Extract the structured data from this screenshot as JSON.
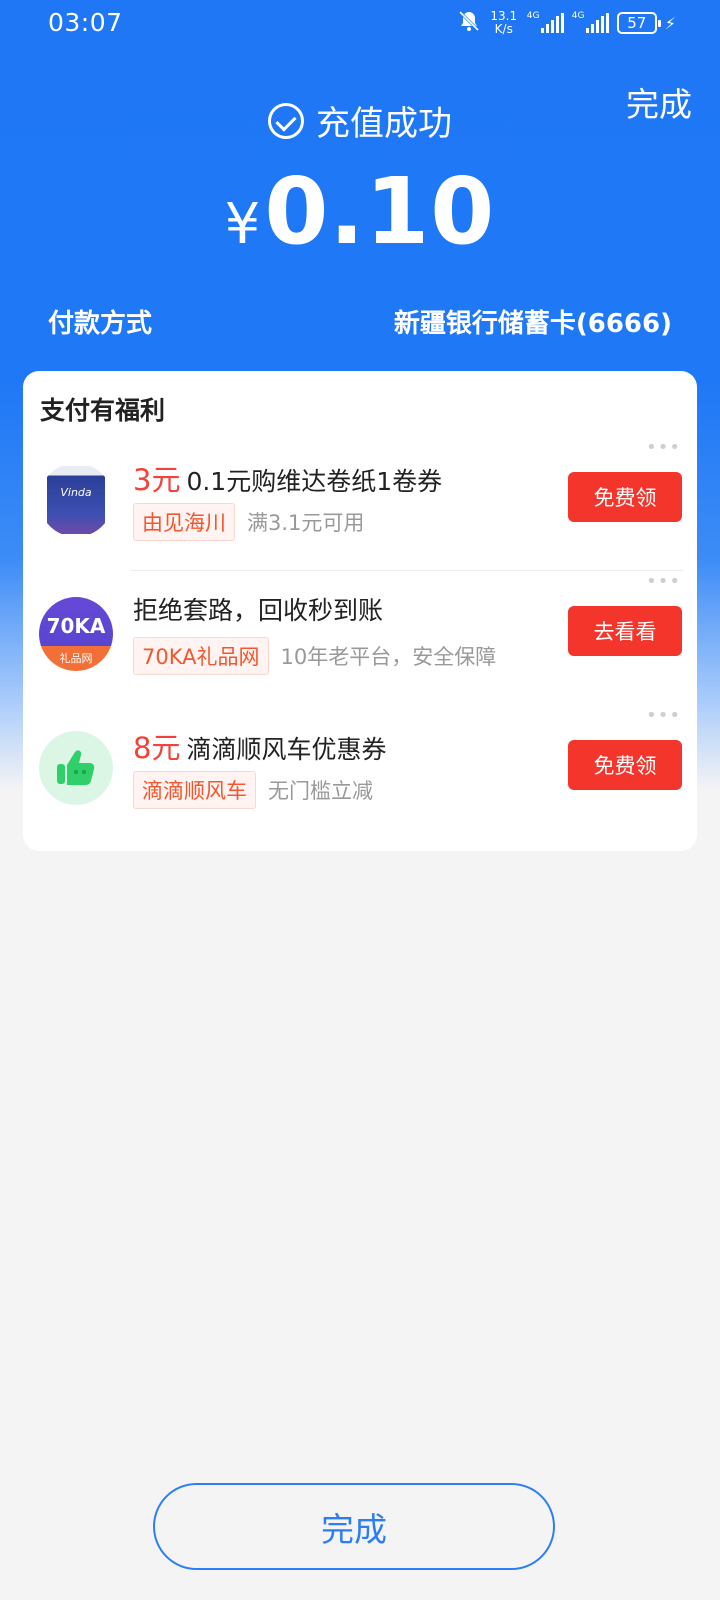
{
  "status_bar": {
    "time": "03:07",
    "net_speed_value": "13.1",
    "net_speed_unit": "K/s",
    "signal_tag": "4G",
    "battery": "57",
    "icons": [
      "bell-muted-icon",
      "signal-icon",
      "battery-icon",
      "charging-icon"
    ]
  },
  "header": {
    "done_label": "完成",
    "success_text": "充值成功",
    "currency": "¥",
    "amount": "0.10"
  },
  "payment": {
    "label": "付款方式",
    "value": "新疆银行储蓄卡(6666)"
  },
  "benefits": {
    "title": "支付有福利",
    "items": [
      {
        "price": "3元",
        "title": "0.1元购维达卷纸1卷券",
        "chip": "由见海川",
        "note": "满3.1元可用",
        "button": "免费领",
        "logo_text": "Vinda",
        "icon": "toilet-paper-icon"
      },
      {
        "price": "",
        "title": "拒绝套路，回收秒到账",
        "chip": "70KA礼品网",
        "note": "10年老平台，安全保障",
        "button": "去看看",
        "logo_text": "70KA",
        "logo_sub": "礼品网",
        "icon": "70ka-logo-icon"
      },
      {
        "price": "8元",
        "title": "滴滴顺风车优惠券",
        "chip": "滴滴顺风车",
        "note": "无门槛立减",
        "button": "免费领",
        "icon": "thumbs-up-icon"
      }
    ]
  },
  "footer": {
    "done_label": "完成"
  },
  "colors": {
    "primary_blue": "#1f77f6",
    "button_red": "#f3352c",
    "price_red": "#f2423a",
    "chip_orange": "#f2572f"
  }
}
